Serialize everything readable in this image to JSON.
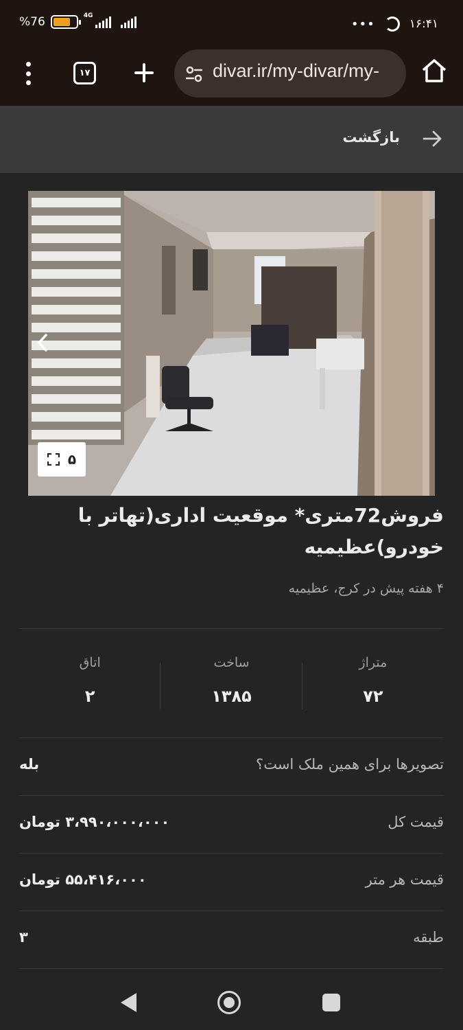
{
  "status_bar": {
    "battery_percent": "76",
    "percent_sign": "%",
    "network": "4G",
    "more_dots": "•••",
    "time": "۱۶:۴۱",
    "battery_level": 0.76
  },
  "browser": {
    "tab_count": "۱۷",
    "url": "divar.ir/my-divar/my-"
  },
  "header": {
    "back_label": "بازگشت"
  },
  "photo": {
    "image_count": "۵"
  },
  "listing": {
    "title": "فروش72متری* موقعیت اداری(تهاتر با خودرو)عظیمیه",
    "subtitle": "۴ هفته پیش در کرج، عظیمیه"
  },
  "stats": [
    {
      "label": "متراژ",
      "value": "۷۲"
    },
    {
      "label": "ساخت",
      "value": "۱۳۸۵"
    },
    {
      "label": "اتاق",
      "value": "۲"
    }
  ],
  "details": [
    {
      "label": "تصویرها برای همین ملک است؟",
      "value": "بله"
    },
    {
      "label": "قیمت کل",
      "value": "۳،۹۹۰،۰۰۰،۰۰۰ تومان"
    },
    {
      "label": "قیمت هر متر",
      "value": "۵۵،۴۱۶،۰۰۰ تومان"
    },
    {
      "label": "طبقه",
      "value": "۳"
    }
  ],
  "colors": {
    "browser_chrome": "#1f1410",
    "url_bar": "#3d2f2a",
    "page_background": "#242424",
    "battery_fill": "#f0a020"
  }
}
